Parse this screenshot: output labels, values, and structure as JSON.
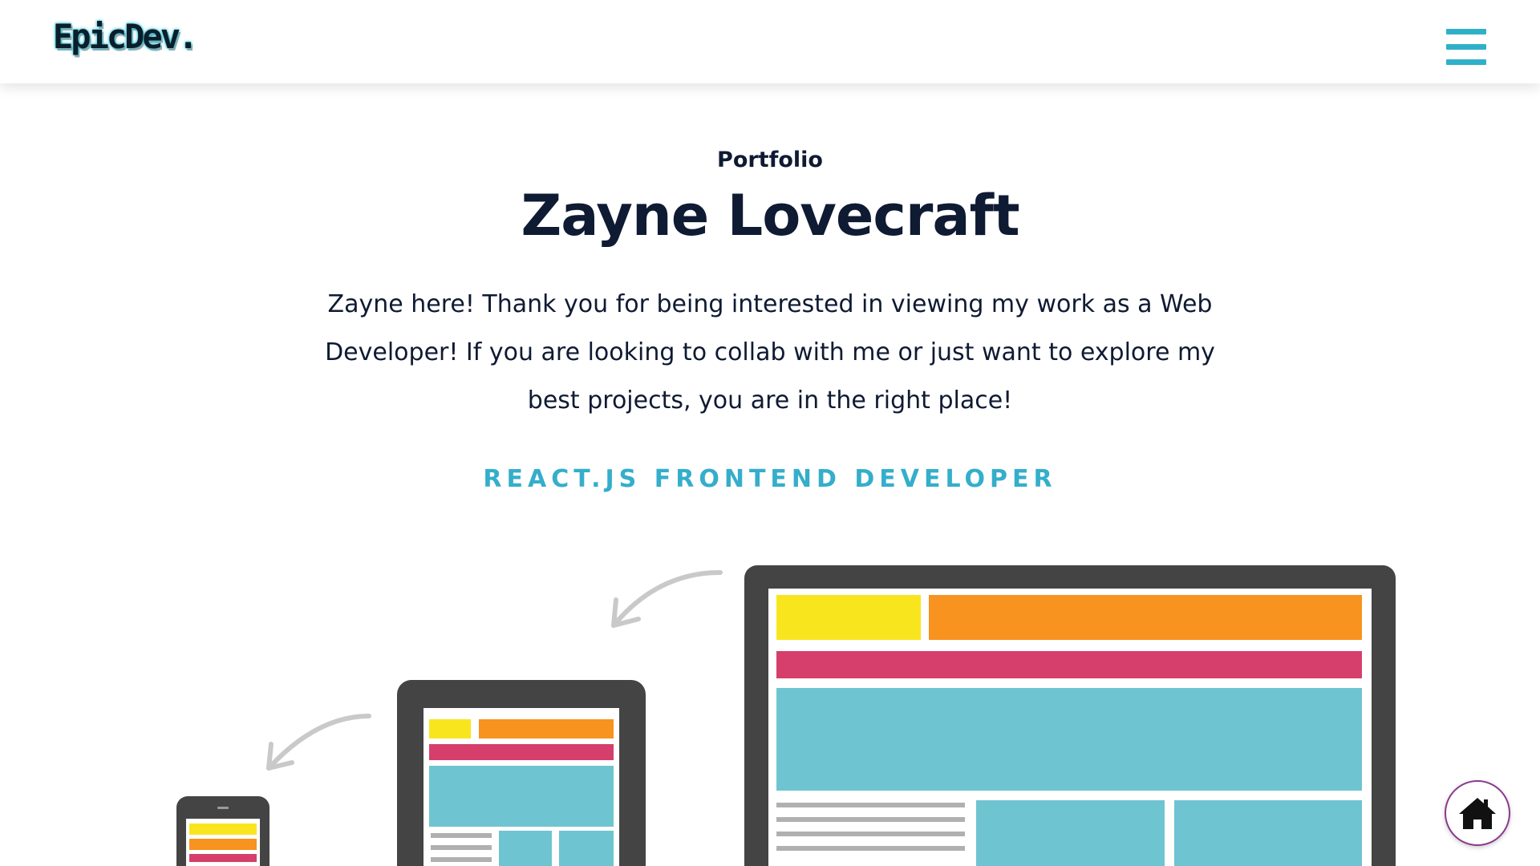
{
  "header": {
    "logo_text": "EpicDev.",
    "menu_icon": "hamburger-menu-icon"
  },
  "hero": {
    "eyebrow": "Portfolio",
    "title": "Zayne Lovecraft",
    "intro": "Zayne here! Thank you for being interested in viewing my work as a Web Developer! If you are looking to collab with me or just want to explore my best projects, you are in the right place!",
    "role": "REACT.JS FRONTEND DEVELOPER"
  },
  "illustration": {
    "icon": "responsive-devices-illustration",
    "colors": {
      "device": "#444444",
      "yellow": "#f9e51e",
      "orange": "#f7931e",
      "pink": "#d63f6b",
      "teal": "#6fc4d1",
      "lines": "#b0b0b0",
      "arrow": "#c9c9c9"
    }
  },
  "fab": {
    "icon": "home-icon"
  },
  "theme": {
    "accent": "#34aecb",
    "text": "#0f1a33",
    "fab_border": "#8a3a8c"
  }
}
